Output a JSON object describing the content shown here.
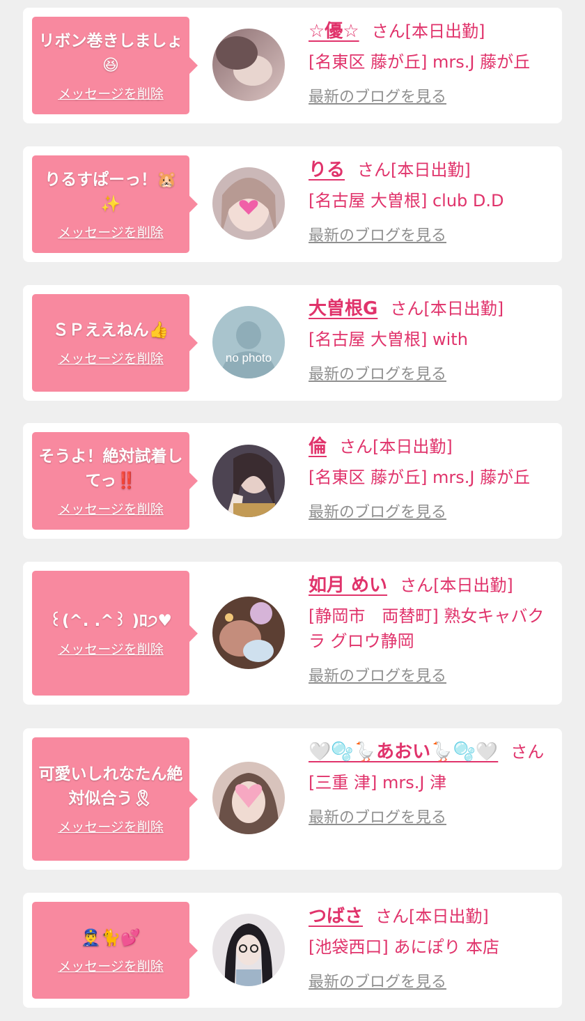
{
  "delete_label": "メッセージを削除",
  "blog_label": "最新のブログを見る",
  "san_label": "さん",
  "shift_label": "[本日出勤]",
  "colors": {
    "accent": "#e0336b",
    "bubble": "#f8899f",
    "background": "#efefef",
    "link_gray": "#8f8f8f"
  },
  "items": [
    {
      "message": "リボン巻きしましょ😆",
      "name": "☆優☆",
      "location": "[名東区 藤が丘] mrs.J 藤が丘"
    },
    {
      "message": "りるすぱーっ！🐹✨",
      "name": "りる",
      "location": "[名古屋 大曽根] club D.D"
    },
    {
      "message": "ＳＰええねん👍",
      "name": "大曽根G",
      "location": "[名古屋 大曽根] with",
      "avatar_text": "no photo"
    },
    {
      "message": "そうよ！絶対試着してっ‼️",
      "name": "倫",
      "location": "[名東区 藤が丘] mrs.J 藤が丘"
    },
    {
      "message": "꒰(^. .^꒱ )ﾛ੭♥",
      "name": "如月 めい",
      "location": "[静岡市　両替町] 熟女キャバクラ グロウ静岡"
    },
    {
      "message": "可愛いしれなたん絶対似合う🎗",
      "name": "🤍🫧🪿あおい🪿🫧🤍",
      "location": "[三重 津] mrs.J 津"
    },
    {
      "message": "👮‍♂️🐈💕",
      "name": "つばさ",
      "location": "[池袋西口] あにぽり 本店"
    }
  ]
}
